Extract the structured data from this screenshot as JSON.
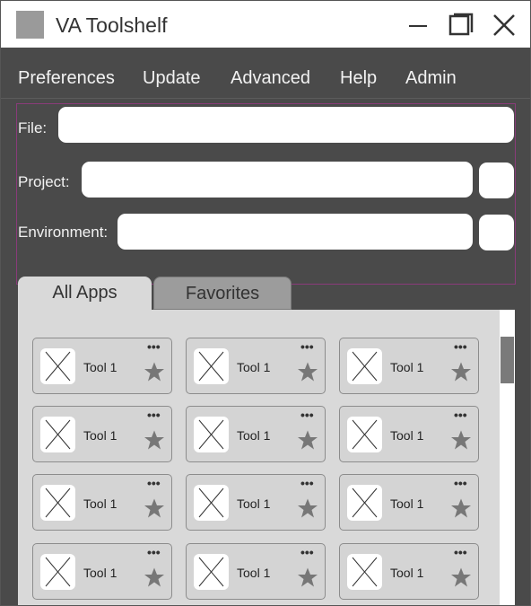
{
  "window": {
    "title": "VA Toolshelf"
  },
  "titlebar_icons": [
    "minimize-icon",
    "restore-icon",
    "close-icon"
  ],
  "menu": [
    "Preferences",
    "Update",
    "Advanced",
    "Help",
    "Admin"
  ],
  "form": {
    "file_label": "File:",
    "file_value": "",
    "project_label": "Project:",
    "project_value": "",
    "environment_label": "Environment:",
    "environment_value": ""
  },
  "tabs": [
    {
      "label": "All Apps",
      "active": true
    },
    {
      "label": "Favorites",
      "active": false
    }
  ],
  "tools": [
    {
      "label": "Tool 1"
    },
    {
      "label": "Tool 1"
    },
    {
      "label": "Tool 1"
    },
    {
      "label": "Tool 1"
    },
    {
      "label": "Tool 1"
    },
    {
      "label": "Tool 1"
    },
    {
      "label": "Tool 1"
    },
    {
      "label": "Tool 1"
    },
    {
      "label": "Tool 1"
    },
    {
      "label": "Tool 1"
    },
    {
      "label": "Tool 1"
    },
    {
      "label": "Tool 1"
    }
  ],
  "card_more_text": "•••",
  "colors": {
    "background": "#4a4a4a",
    "panel": "#d9d9d9",
    "accent_border": "#8a3b7a"
  }
}
